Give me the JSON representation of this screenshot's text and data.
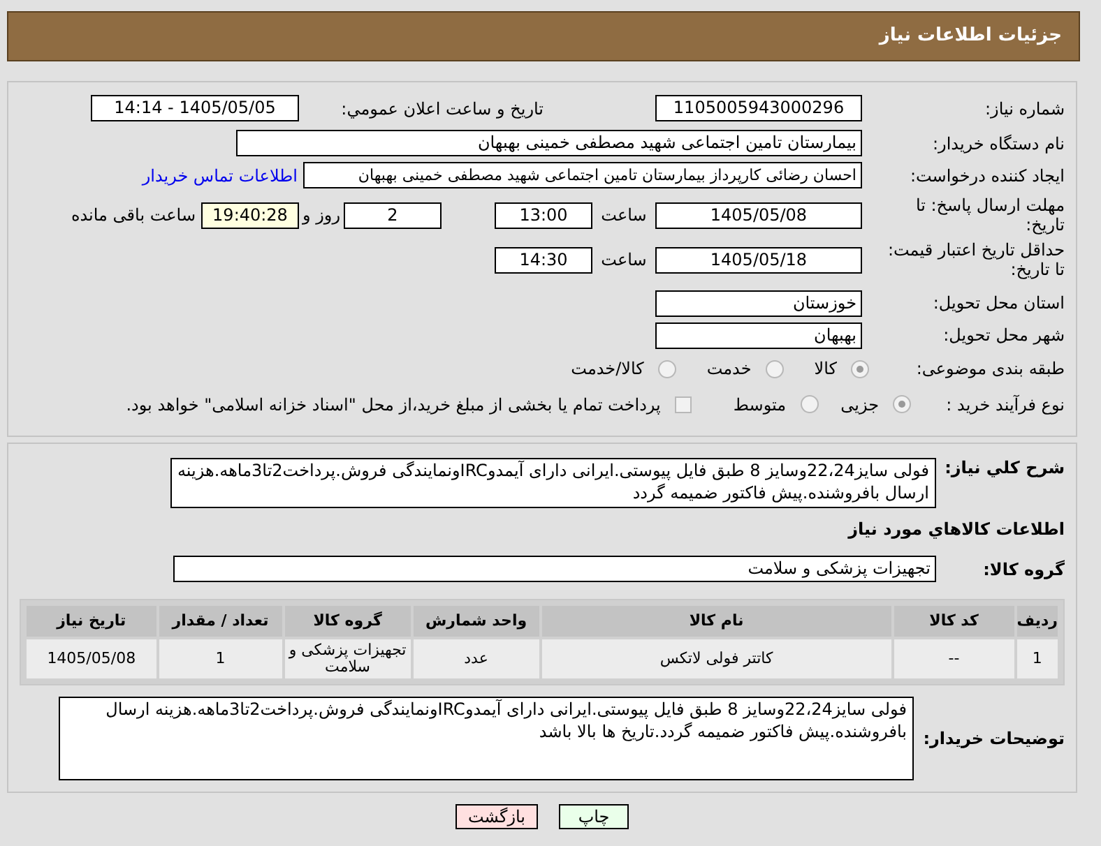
{
  "header": {
    "title": "جزئیات اطلاعات نیاز"
  },
  "need_number": {
    "label": "شماره نیاز:",
    "value": "1105005943000296"
  },
  "announce": {
    "label": "تاريخ و ساعت اعلان عمومي:",
    "value": "1405/05/05 - 14:14"
  },
  "buyer_org": {
    "label": "نام دستگاه خریدار:",
    "value": "بیمارستان تامین اجتماعی شهید مصطفی خمینی بهبهان"
  },
  "creator": {
    "label": "ایجاد کننده درخواست:",
    "value": "احسان رضائی کارپرداز بیمارستان تامین اجتماعی شهید مصطفی خمینی بهبهان",
    "link": "اطلاعات تماس خریدار"
  },
  "deadline": {
    "label": "مهلت ارسال پاسخ: تا تاریخ:",
    "date": "1405/05/08",
    "time_label": "ساعت",
    "time": "13:00",
    "days": "2",
    "days_label": "روز و",
    "remaining": "19:40:28",
    "remaining_label": "ساعت باقی مانده"
  },
  "price_validity": {
    "label": "حداقل تاریخ اعتبار قیمت: تا تاریخ:",
    "date": "1405/05/18",
    "time_label": "ساعت",
    "time": "14:30"
  },
  "province": {
    "label": "استان محل تحویل:",
    "value": "خوزستان"
  },
  "city": {
    "label": "شهر محل تحویل:",
    "value": "بهبهان"
  },
  "category": {
    "label": "طبقه بندی موضوعی:",
    "options": [
      {
        "label": "کالا",
        "selected": true
      },
      {
        "label": "خدمت",
        "selected": false
      },
      {
        "label": "کالا/خدمت",
        "selected": false
      }
    ]
  },
  "process": {
    "label": "نوع فرآیند خرید :",
    "options": [
      {
        "label": "جزیی",
        "selected": true
      },
      {
        "label": "متوسط",
        "selected": false
      }
    ],
    "treasury": {
      "checked": false,
      "label": "پرداخت تمام یا بخشی از مبلغ خرید،از محل \"اسناد خزانه اسلامی\" خواهد بود."
    }
  },
  "description": {
    "label": "شرح کلي نياز:",
    "value": "فولی سایز22،24وسایز 8 طبق فایل پیوستی.ایرانی دارای آیمدوIRCونمایندگی فروش.پرداخت2تا3ماهه.هزینه ارسال بافروشنده.پیش فاکتور ضمیمه گردد"
  },
  "items_heading": "اطلاعات کالاهاي مورد نياز",
  "goods_group": {
    "label": "گروه کالا:",
    "value": "تجهیزات پزشکی و سلامت"
  },
  "table": {
    "columns": [
      "رديف",
      "کد کالا",
      "نام کالا",
      "واحد شمارش",
      "گروه کالا",
      "تعداد / مقدار",
      "تاريخ نياز"
    ],
    "rows": [
      [
        "1",
        "--",
        "کاتتر فولی لاتکس",
        "عدد",
        "تجهیزات پزشکی و سلامت",
        "1",
        "1405/05/08"
      ]
    ]
  },
  "buyer_notes": {
    "label": "توضیحات خریدار:",
    "value": "فولی سایز22،24وسایز 8 طبق فایل پیوستی.ایرانی دارای آیمدوIRCونمایندگی فروش.پرداخت2تا3ماهه.هزینه ارسال بافروشنده.پیش فاکتور ضمیمه گردد.تاریخ ها بالا باشد"
  },
  "buttons": [
    {
      "label": "چاپ",
      "kind": "print"
    },
    {
      "label": "بازگشت",
      "kind": "back"
    }
  ]
}
